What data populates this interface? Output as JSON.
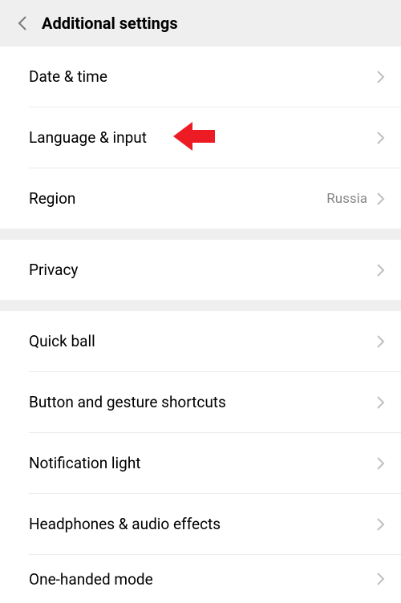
{
  "header": {
    "title": "Additional settings"
  },
  "groups": [
    {
      "items": [
        {
          "label": "Date & time",
          "value": ""
        },
        {
          "label": "Language & input",
          "value": "",
          "highlight": true
        },
        {
          "label": "Region",
          "value": "Russia"
        }
      ]
    },
    {
      "items": [
        {
          "label": "Privacy",
          "value": ""
        }
      ]
    },
    {
      "items": [
        {
          "label": "Quick ball",
          "value": ""
        },
        {
          "label": "Button and gesture shortcuts",
          "value": ""
        },
        {
          "label": "Notification light",
          "value": ""
        },
        {
          "label": "Headphones & audio effects",
          "value": ""
        },
        {
          "label": "One-handed mode",
          "value": ""
        }
      ]
    }
  ]
}
